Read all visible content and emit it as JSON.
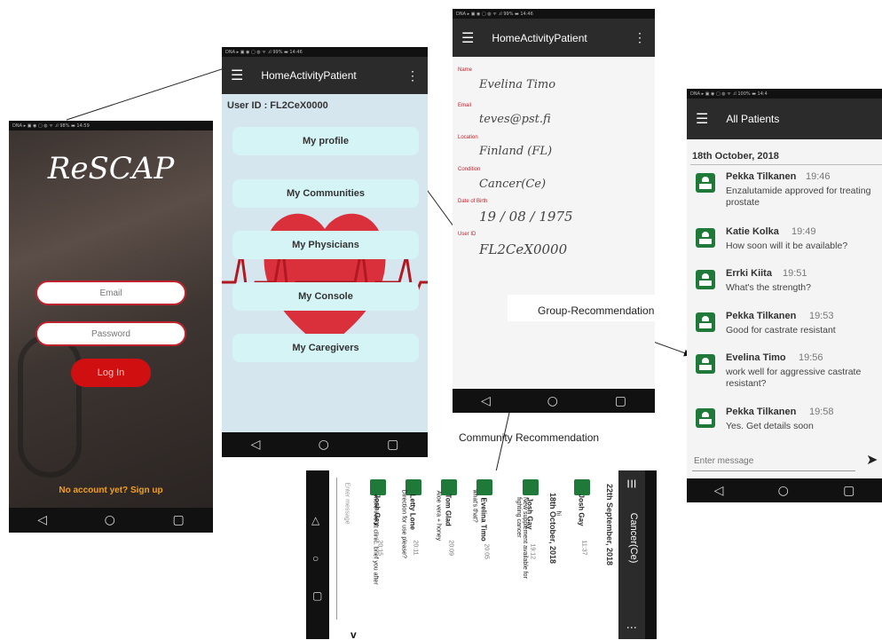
{
  "login": {
    "status": "DNA ▸ ▣ ◉   ▢ ◍ ᯤ .ıl 98% ▬ 14:59",
    "app_title": "ReSCAP",
    "email_placeholder": "Email",
    "password_placeholder": "Password",
    "login_label": "Log In",
    "signup_label": "No account yet? Sign up"
  },
  "home": {
    "status": "DNA ▸ ▣ ◉   ▢ ◍ ᯤ .ıl 99% ▬ 14:46",
    "title": "HomeActivityPatient",
    "user_id": "User ID : FL2CeX0000",
    "buttons": [
      "My profile",
      "My Communities",
      "My Physicians",
      "My Console",
      "My Caregivers"
    ]
  },
  "profile": {
    "status": "DNA ▸ ▣ ◉   ▢ ◍ ᯤ .ıl 99% ▬ 14:46",
    "title": "HomeActivityPatient",
    "fields": [
      {
        "label": "Name",
        "value": "Evelina Timo"
      },
      {
        "label": "Email",
        "value": "teves@pst.fi"
      },
      {
        "label": "Location",
        "value": "Finland (FL)"
      },
      {
        "label": "Condition",
        "value": "Cancer(Ce)"
      },
      {
        "label": "Date of Birth",
        "value": "19 / 08 / 1975"
      },
      {
        "label": "User ID",
        "value": "FL2CeX0000"
      }
    ]
  },
  "group_label": "Group-Recommendation",
  "community_label": "Community Recommendation",
  "patients": {
    "status": "DNA ▸ ▣ ◉   ▢ ◍ ᯤ .ıl 100% ▬ 14:4",
    "title": "All Patients",
    "date": "18th October, 2018",
    "messages": [
      {
        "name": "Pekka Tilkanen",
        "time": "19:46",
        "text": "Enzalutamide approved for treating prostate"
      },
      {
        "name": "Katie Kolka",
        "time": "19:49",
        "text": "How soon will it be available?"
      },
      {
        "name": "Errki Kiita",
        "time": "19:51",
        "text": "What's the strength?"
      },
      {
        "name": "Pekka Tilkanen",
        "time": "19:53",
        "text": "Good for castrate resistant"
      },
      {
        "name": "Evelina Timo",
        "time": "19:56",
        "text": "work well for aggressive castrate resistant?"
      },
      {
        "name": "Pekka Tilkanen",
        "time": "19:58",
        "text": "Yes. Get details soon"
      }
    ],
    "input_placeholder": "Enter message"
  },
  "community": {
    "status": "DNA ▸ ▣ ◉   ▢ ◍ ᯤ .ıl 100% ▬ 14:",
    "title": "Cancer(Ce)",
    "date1": "22th September, 2018",
    "date2": "18th October, 2018",
    "messages": [
      {
        "name": "Josh Gay",
        "time": "11:37",
        "text": "hi"
      },
      {
        "name": "Josh Gay",
        "time": "19:12",
        "text": "New supplement available for fighting cancer"
      },
      {
        "name": "Evelina Timo",
        "time": "20:05",
        "text": "what's that?"
      },
      {
        "name": "Tom Glad",
        "time": "20:09",
        "text": "Aloe vera + honey"
      },
      {
        "name": "Letty Lone",
        "time": "20:11",
        "text": "Direction for use please?"
      },
      {
        "name": "Josh Gay",
        "time": "20:15",
        "text": "more info at clinic. brief you after"
      }
    ],
    "input_placeholder": "Enter message"
  },
  "nav": {
    "back": "◁",
    "home": "○",
    "recent": "▢"
  }
}
